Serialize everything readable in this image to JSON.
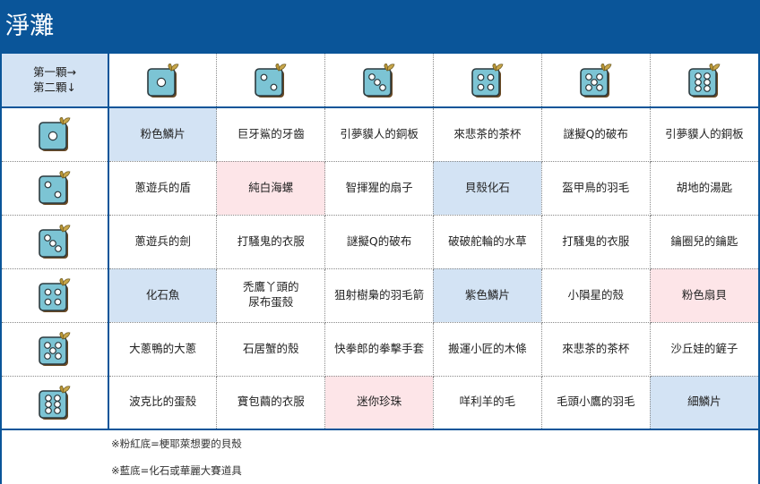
{
  "page": {
    "title": "淨灘"
  },
  "corner": {
    "line1": "第一顆→",
    "line2": "第二顆↓"
  },
  "dice_icon": "dice-with-leaf-icon",
  "colors": {
    "header": "#0a5599",
    "pink": "#fde5e8",
    "blue": "#d3e3f4",
    "die": "#7cc4d4"
  },
  "columns": [
    1,
    2,
    3,
    4,
    5,
    6
  ],
  "rows": [
    {
      "die": 1,
      "cells": [
        {
          "text": "粉色鱗片",
          "bg": "blue"
        },
        {
          "text": "巨牙鯊的牙齒",
          "bg": ""
        },
        {
          "text": "引夢貘人的銅板",
          "bg": ""
        },
        {
          "text": "來悲茶的茶杯",
          "bg": ""
        },
        {
          "text": "謎擬Q的破布",
          "bg": ""
        },
        {
          "text": "引夢貘人的銅板",
          "bg": ""
        }
      ]
    },
    {
      "die": 2,
      "cells": [
        {
          "text": "蔥遊兵的盾",
          "bg": ""
        },
        {
          "text": "純白海螺",
          "bg": "pink"
        },
        {
          "text": "智揮猩的扇子",
          "bg": ""
        },
        {
          "text": "貝殼化石",
          "bg": "blue"
        },
        {
          "text": "盔甲鳥的羽毛",
          "bg": ""
        },
        {
          "text": "胡地的湯匙",
          "bg": ""
        }
      ]
    },
    {
      "die": 3,
      "cells": [
        {
          "text": "蔥遊兵的劍",
          "bg": ""
        },
        {
          "text": "打騷鬼的衣服",
          "bg": ""
        },
        {
          "text": "謎擬Q的破布",
          "bg": ""
        },
        {
          "text": "破破舵輪的水草",
          "bg": ""
        },
        {
          "text": "打騷鬼的衣服",
          "bg": ""
        },
        {
          "text": "鑰圈兒的鑰匙",
          "bg": ""
        }
      ]
    },
    {
      "die": 4,
      "cells": [
        {
          "text": "化石魚",
          "bg": "blue"
        },
        {
          "text": "禿鷹丫頭的\n尿布蛋殼",
          "bg": ""
        },
        {
          "text": "狙射樹梟的羽毛箭",
          "bg": ""
        },
        {
          "text": "紫色鱗片",
          "bg": "blue"
        },
        {
          "text": "小隕星的殼",
          "bg": ""
        },
        {
          "text": "粉色扇貝",
          "bg": "pink"
        }
      ]
    },
    {
      "die": 5,
      "cells": [
        {
          "text": "大蔥鴨的大蔥",
          "bg": ""
        },
        {
          "text": "石居蟹的殼",
          "bg": ""
        },
        {
          "text": "快拳郎的拳擊手套",
          "bg": ""
        },
        {
          "text": "搬運小匠的木條",
          "bg": ""
        },
        {
          "text": "來悲茶的茶杯",
          "bg": ""
        },
        {
          "text": "沙丘娃的鏟子",
          "bg": ""
        }
      ]
    },
    {
      "die": 6,
      "cells": [
        {
          "text": "波克比的蛋殼",
          "bg": ""
        },
        {
          "text": "寶包繭的衣服",
          "bg": ""
        },
        {
          "text": "迷你珍珠",
          "bg": "pink"
        },
        {
          "text": "咩利羊的毛",
          "bg": ""
        },
        {
          "text": "毛頭小鷹的羽毛",
          "bg": ""
        },
        {
          "text": "細鱗片",
          "bg": "blue"
        }
      ]
    }
  ],
  "notes": [
    "※粉紅底=梗耶萊想要的貝殼",
    "※藍底=化石或華麗大賽道具"
  ]
}
